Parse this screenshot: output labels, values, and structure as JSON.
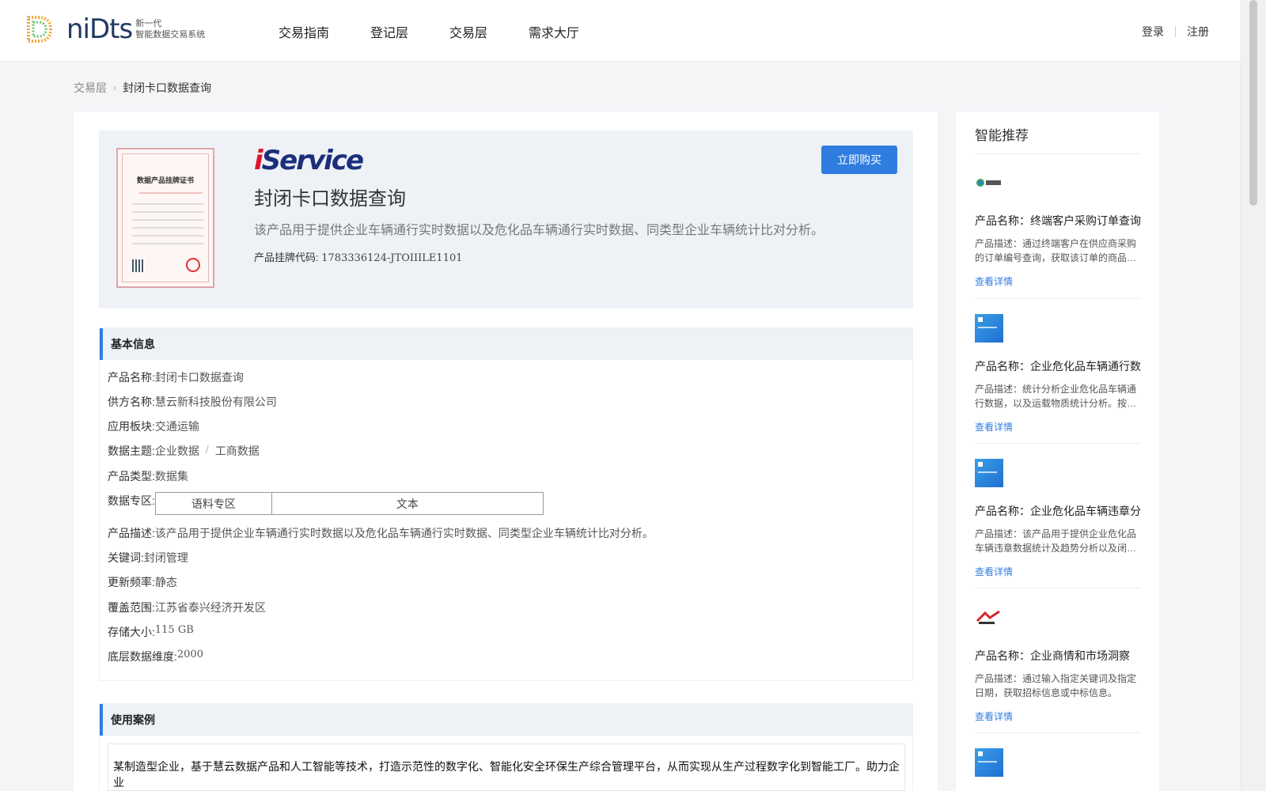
{
  "header": {
    "logo_word": "niDts",
    "logo_sub_1": "新一代",
    "logo_sub_2": "智能数据交易系统",
    "nav": [
      "交易指南",
      "登记层",
      "交易层",
      "需求大厅"
    ],
    "login": "登录",
    "register": "注册"
  },
  "breadcrumb": {
    "parent": "交易层",
    "current": "封闭卡口数据查询"
  },
  "product": {
    "brand_i": "i",
    "brand_rest": "Service",
    "cert_title": "数据产品挂牌证书",
    "title": "封闭卡口数据查询",
    "description": "该产品用于提供企业车辆通行实时数据以及危化品车辆通行实时数据、同类型企业车辆统计比对分析。",
    "code_label": "产品挂牌代码:",
    "code_value": "1783336124-JTOIIILE1101",
    "buy_label": "立即购买"
  },
  "basic_info": {
    "heading": "基本信息",
    "name_label": "产品名称:",
    "name_value": "封闭卡口数据查询",
    "supplier_label": "供方名称:",
    "supplier_value": "慧云新科技股份有限公司",
    "sector_label": "应用板块:",
    "sector_value": "交通运输",
    "theme_label": "数据主题:",
    "theme_value_1": "企业数据",
    "theme_sep": "/",
    "theme_value_2": "工商数据",
    "type_label": "产品类型:",
    "type_value": "数据集",
    "zone_label": "数据专区:",
    "zone_col_1": "语料专区",
    "zone_col_2": "文本",
    "desc_label": "产品描述:",
    "desc_value": "该产品用于提供企业车辆通行实时数据以及危化品车辆通行实时数据、同类型企业车辆统计比对分析。",
    "keyword_label": "关键词:",
    "keyword_value": "封闭管理",
    "freq_label": "更新频率:",
    "freq_value": "静态",
    "coverage_label": "覆盖范围:",
    "coverage_value": "江苏省泰兴经济开发区",
    "storage_label": "存储大小:",
    "storage_value": "115 GB",
    "dim_label": "底层数据维度:",
    "dim_value": "2000"
  },
  "use_case": {
    "heading": "使用案例",
    "text": "某制造型企业，基于慧云数据产品和人工智能等技术，打造示范性的数字化、智能化安全环保生产综合管理平台，从而实现从生产过程数字化到智能工厂。助力企业"
  },
  "sidebar": {
    "title": "智能推荐",
    "items": [
      {
        "name": "产品名称：终端客户采购订单查询服务",
        "desc": "产品描述：通过终端客户在供应商采购的订单编号查询，获取该订单的商品信息。",
        "link": "查看详情",
        "icon": "brand-logo-icon"
      },
      {
        "name": "产品名称：企业危化品车辆通行数据统计",
        "desc": "产品描述：统计分析企业危化品车辆通行数据，以及运载物质统计分析。按月统计。",
        "link": "查看详情",
        "icon": "blue-tile-icon"
      },
      {
        "name": "产品名称：企业危化品车辆违章分析",
        "desc": "产品描述：该产品用于提供企业危化品车辆违章数据统计及趋势分析以及闭环处置。",
        "link": "查看详情",
        "icon": "blue-tile-icon"
      },
      {
        "name": "产品名称：企业商情和市场洞察",
        "desc": "产品描述：通过输入指定关键词及指定日期，获取招标信息或中标信息。",
        "link": "查看详情",
        "icon": "brand-logo-icon"
      }
    ]
  },
  "colors": {
    "accent": "#2f7de1",
    "brand_red": "#e0162b",
    "brand_navy": "#1c2f7a"
  }
}
